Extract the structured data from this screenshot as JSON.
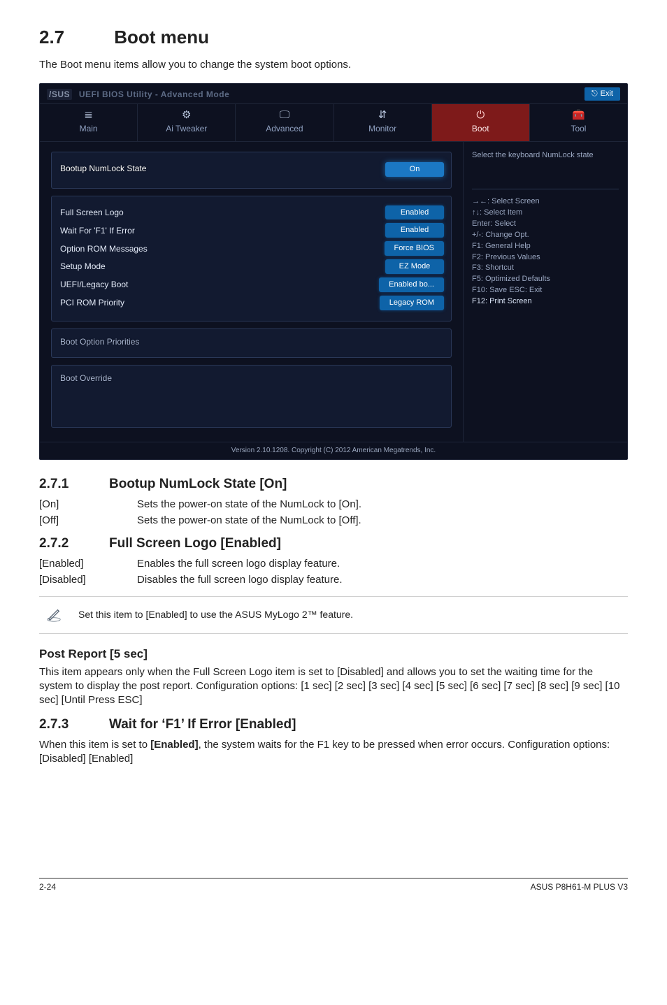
{
  "section": {
    "number": "2.7",
    "title": "Boot menu"
  },
  "intro": "The Boot menu items allow you to change the system boot options.",
  "bios": {
    "titlebar": {
      "brand_prefix": "/SUS",
      "brand_text": "UEFI BIOS Utility - Advanced Mode",
      "exit_label": "Exit"
    },
    "tabs": [
      {
        "icon": "≣",
        "label": "Main"
      },
      {
        "icon": "⚙",
        "label": "Ai Tweaker"
      },
      {
        "icon": "🖵",
        "label": "Advanced"
      },
      {
        "icon": "⇵",
        "label": "Monitor"
      },
      {
        "icon": "⏻",
        "label": "Boot",
        "active": true
      },
      {
        "icon": "🧰",
        "label": "Tool"
      }
    ],
    "group1": {
      "header": "Bootup NumLock State",
      "value": "On"
    },
    "group2_rows": [
      {
        "label": "Full Screen Logo",
        "value": "Enabled"
      },
      {
        "label": "Wait For 'F1' If Error",
        "value": "Enabled"
      },
      {
        "label": "Option ROM Messages",
        "value": "Force BIOS"
      },
      {
        "label": "Setup Mode",
        "value": "EZ Mode"
      },
      {
        "label": "UEFI/Legacy Boot",
        "value": "Enabled bo..."
      },
      {
        "label": "PCI ROM Priority",
        "value": "Legacy ROM"
      }
    ],
    "group3_header": "Boot Option Priorities",
    "group4_header": "Boot Override",
    "help_top": "Select the keyboard NumLock state",
    "help_keys": [
      "→←: Select Screen",
      "↑↓: Select Item",
      "Enter: Select",
      "+/-: Change Opt.",
      "F1: General Help",
      "F2: Previous Values",
      "F3: Shortcut",
      "F5: Optimized Defaults",
      "F10: Save  ESC: Exit",
      "F12: Print Screen"
    ],
    "footer": "Version 2.10.1208. Copyright (C) 2012 American Megatrends, Inc."
  },
  "s271": {
    "num": "2.7.1",
    "title": "Bootup NumLock State [On]",
    "rows": [
      {
        "k": "[On]",
        "v": "Sets the power-on state of the NumLock to [On]."
      },
      {
        "k": "[Off]",
        "v": "Sets the power-on state of the NumLock to [Off]."
      }
    ]
  },
  "s272": {
    "num": "2.7.2",
    "title": "Full Screen Logo [Enabled]",
    "rows": [
      {
        "k": "[Enabled]",
        "v": "Enables the full screen logo display feature."
      },
      {
        "k": "[Disabled]",
        "v": "Disables the full screen logo display feature."
      }
    ]
  },
  "callout": "Set this item to [Enabled] to use the ASUS MyLogo 2™ feature.",
  "post_report": {
    "title": "Post Report [5 sec]",
    "body": "This item appears only when the Full Screen Logo item is set to [Disabled] and allows you to set the waiting time for the system to display the post report. Configuration options: [1 sec] [2 sec] [3 sec] [4 sec] [5 sec] [6 sec] [7 sec] [8 sec] [9 sec] [10 sec] [Until Press ESC]"
  },
  "s273": {
    "num": "2.7.3",
    "title": "Wait for ‘F1’ If Error [Enabled]",
    "body_pre": "When this item is set to ",
    "body_bold": "[Enabled]",
    "body_post": ", the system waits for the F1 key to be pressed when error occurs. Configuration options: [Disabled] [Enabled]"
  },
  "footer": {
    "left": "2-24",
    "right": "ASUS P8H61-M PLUS V3"
  }
}
